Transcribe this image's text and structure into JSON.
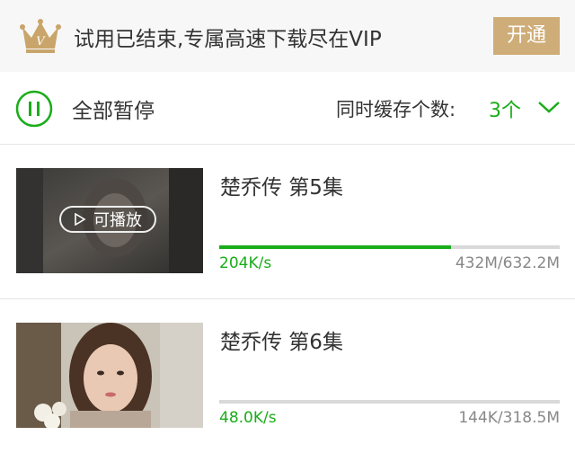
{
  "vip_banner": {
    "message": "试用已结束,专属高速下载尽在VIP",
    "open_button_label": "开通",
    "crown_icon": "vip-crown-icon"
  },
  "controls": {
    "pause_all_label": "全部暂停",
    "cache_count_label": "同时缓存个数:",
    "cache_count_value": "3个",
    "pause_icon": "pause-circle-icon",
    "dropdown_icon": "chevron-down-icon"
  },
  "colors": {
    "accent_green": "#1aad19",
    "vip_gold": "#cfad78"
  },
  "downloads": [
    {
      "title": "楚乔传 第5集",
      "speed": "204K/s",
      "size": "432M/632.2M",
      "progress": 0.68,
      "play_label": "可播放"
    },
    {
      "title": "楚乔传 第6集",
      "speed": "48.0K/s",
      "size": "144K/318.5M",
      "progress": 0.0
    }
  ]
}
